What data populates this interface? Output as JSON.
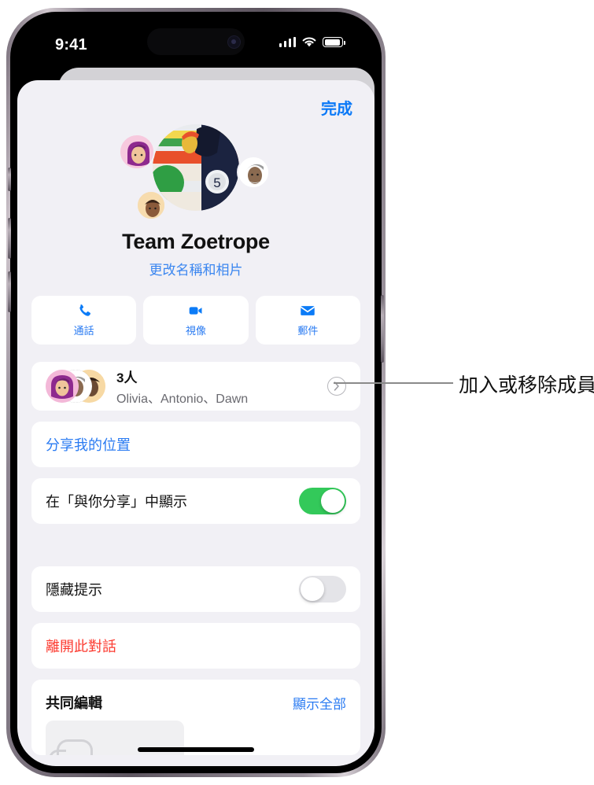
{
  "status_bar": {
    "time": "9:41",
    "cellular_icon": "signal-bars-icon",
    "wifi_icon": "wifi-icon",
    "battery_icon": "battery-icon"
  },
  "sheet": {
    "done_label": "完成",
    "group": {
      "name": "Team Zoetrope",
      "change_link": "更改名稱和相片",
      "avatar_icon": "group-photo-avatar"
    },
    "actions": [
      {
        "label": "通話",
        "icon": "phone-icon"
      },
      {
        "label": "視像",
        "icon": "video-camera-icon"
      },
      {
        "label": "郵件",
        "icon": "mail-envelope-icon"
      }
    ],
    "members": {
      "count_label": "3人",
      "names": "Olivia、Antonio、Dawn",
      "disclosure_icon": "chevron-right-circle-icon"
    },
    "share_location_label": "分享我的位置",
    "show_in_shared_with_you": {
      "label": "在「與你分享」中顯示",
      "toggle_state": "on"
    },
    "hide_alerts": {
      "label": "隱藏提示",
      "toggle_state": "off"
    },
    "leave_conversation_label": "離開此對話",
    "collaboration": {
      "title": "共同編輯",
      "show_all_label": "顯示全部"
    }
  },
  "annotation": {
    "callout_text": "加入或移除成員。"
  },
  "colors": {
    "ios_blue": "#2a7bf2",
    "ios_red": "#fc3b30",
    "ios_green": "#33c95a",
    "sheet_bg": "#f1f0f5"
  }
}
